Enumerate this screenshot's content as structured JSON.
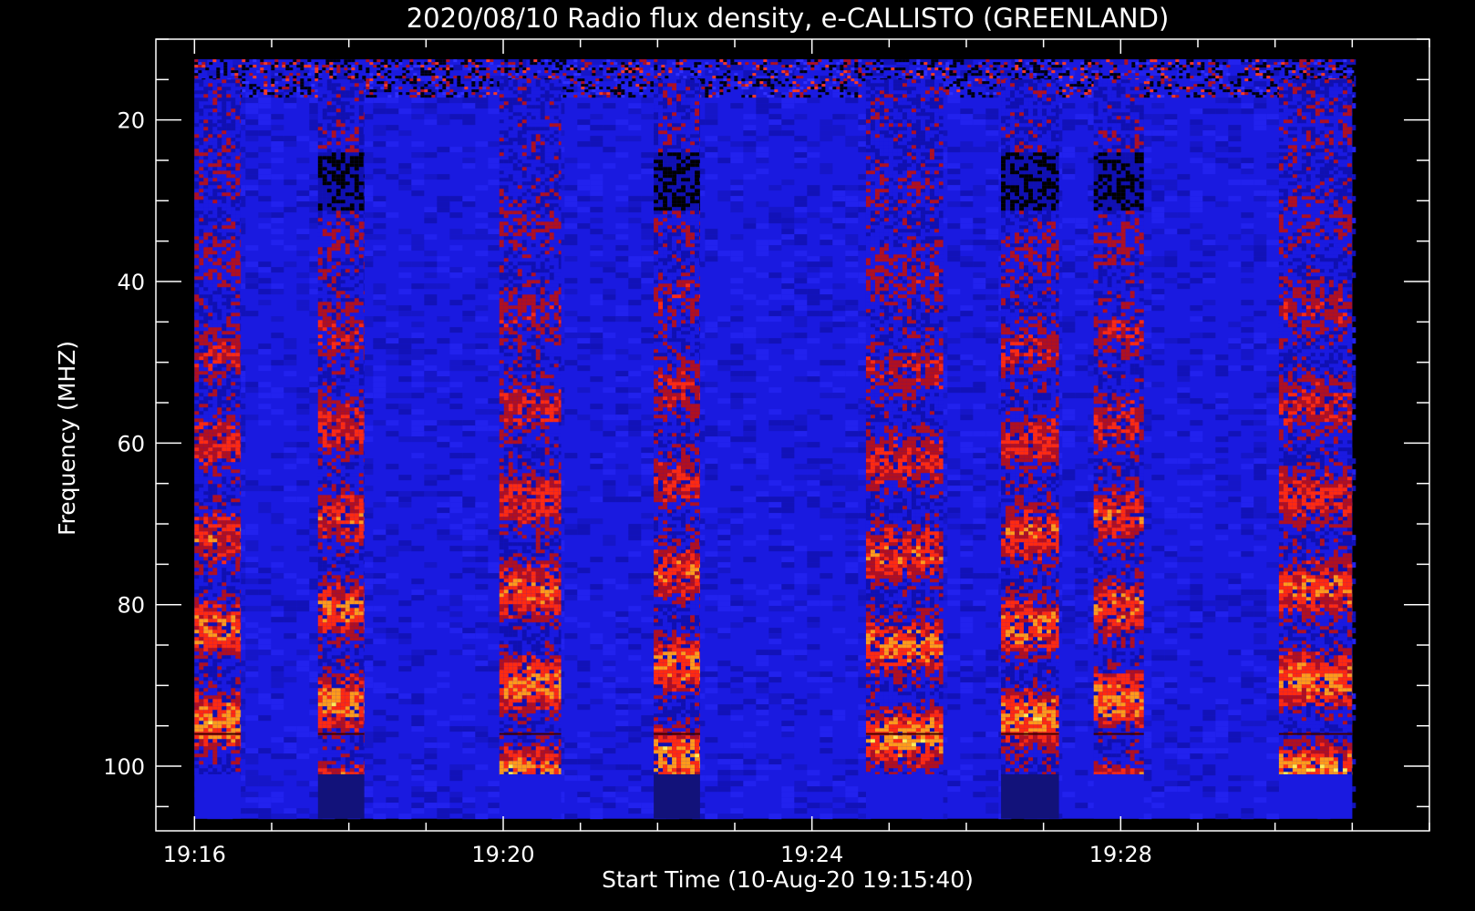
{
  "chart_data": {
    "type": "heatmap",
    "title": "2020/08/10  Radio flux density, e-CALLISTO (GREENLAND)",
    "xlabel": "Start Time (10-Aug-20 19:15:40)",
    "ylabel": "Frequency (MHZ)",
    "x_range_minutes": [
      15.5,
      32.0
    ],
    "y_range_mhz": [
      10,
      108
    ],
    "y_inverted": true,
    "x_ticks": [
      {
        "minute": 16,
        "label": "19:16"
      },
      {
        "minute": 20,
        "label": "19:20"
      },
      {
        "minute": 24,
        "label": "19:24"
      },
      {
        "minute": 28,
        "label": "19:28"
      }
    ],
    "x_minor_step_minutes": 1,
    "y_ticks": [
      {
        "mhz": 20,
        "label": "20"
      },
      {
        "mhz": 40,
        "label": "40"
      },
      {
        "mhz": 60,
        "label": "60"
      },
      {
        "mhz": 80,
        "label": "80"
      },
      {
        "mhz": 100,
        "label": "100"
      }
    ],
    "y_minor_step_mhz": 5,
    "data_extent": {
      "minute_start": 16.0,
      "minute_end": 31.0,
      "mhz_start": 12.5,
      "mhz_end": 106.5
    },
    "interference_line_mhz": 96,
    "burst_bands": [
      {
        "minute_start": 16.0,
        "minute_end": 16.6
      },
      {
        "minute_start": 17.6,
        "minute_end": 18.2
      },
      {
        "minute_start": 19.95,
        "minute_end": 20.75
      },
      {
        "minute_start": 21.95,
        "minute_end": 22.55
      },
      {
        "minute_start": 24.7,
        "minute_end": 25.7
      },
      {
        "minute_start": 26.45,
        "minute_end": 27.2
      },
      {
        "minute_start": 27.65,
        "minute_end": 28.3
      },
      {
        "minute_start": 30.05,
        "minute_end": 31.0
      }
    ],
    "colormap": [
      "#000000",
      "#1010b0",
      "#1a1ae0",
      "#b01020",
      "#ff2a10",
      "#ff9a1a",
      "#ffee55"
    ]
  }
}
